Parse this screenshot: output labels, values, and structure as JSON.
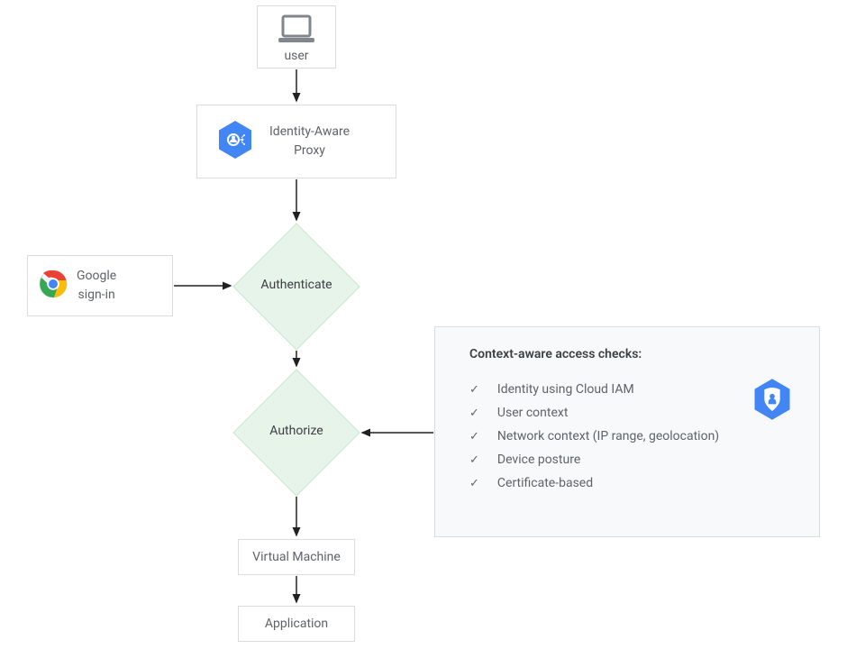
{
  "user_node": {
    "label": "user"
  },
  "iap_node": {
    "label": "Identity-Aware\nProxy"
  },
  "signin_node": {
    "label": "Google\nsign-in"
  },
  "authenticate_node": {
    "label": "Authenticate"
  },
  "authorize_node": {
    "label": "Authorize"
  },
  "vm_node": {
    "label": "Virtual Machine"
  },
  "app_node": {
    "label": "Application"
  },
  "context_panel": {
    "heading": "Context-aware access checks:",
    "items": [
      "Identity using Cloud IAM",
      "User context",
      "Network context (IP range, geolocation)",
      "Device posture",
      "Certificate-based"
    ]
  },
  "colors": {
    "border": "#dadce0",
    "diamond_fill": "#e6f4ea",
    "hex_blue": "#4285f4",
    "text": "#5f6368"
  }
}
